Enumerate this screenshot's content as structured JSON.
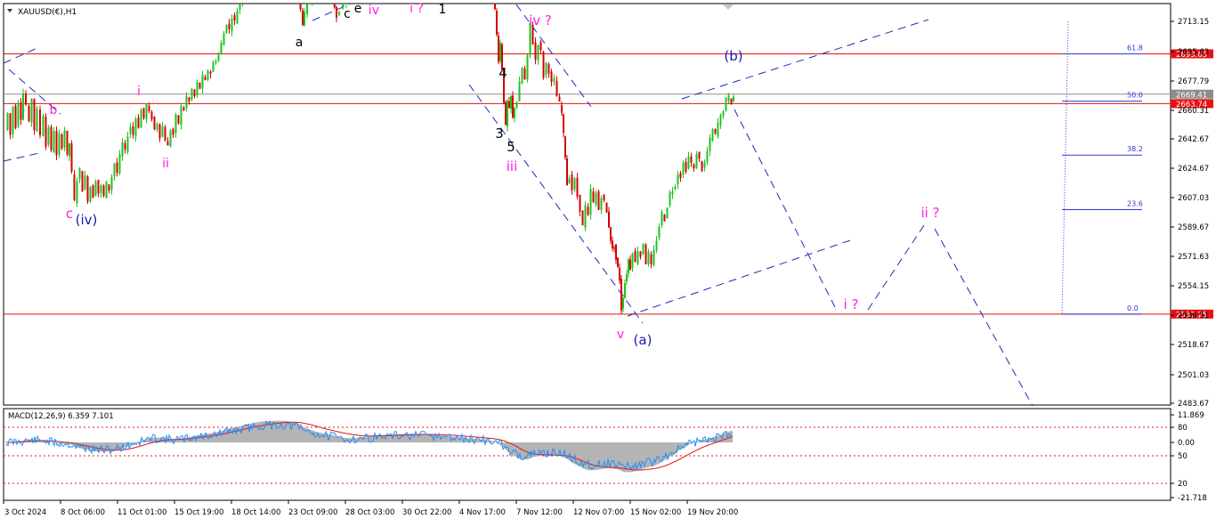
{
  "window": {
    "symbol_label": "XAUUSD(€),H1"
  },
  "chart_data": {
    "type": "candlestick",
    "symbol": "XAUUSD(€)",
    "timeframe": "H1",
    "ylim": [
      2483.67,
      2720.0
    ],
    "y_ticks": [
      "2713.15",
      "2695.63",
      "2677.79",
      "2660.31",
      "2642.67",
      "2624.67",
      "2607.03",
      "2589.67",
      "2571.63",
      "2554.15",
      "2536.51",
      "2518.67",
      "2501.03",
      "2483.67"
    ],
    "x_ticks": [
      "3 Oct 2024",
      "8 Oct 06:00",
      "11 Oct 01:00",
      "15 Oct 19:00",
      "18 Oct 14:00",
      "23 Oct 09:00",
      "28 Oct 03:00",
      "30 Oct 22:00",
      "4 Nov 17:00",
      "7 Nov 12:00",
      "12 Nov 07:00",
      "15 Nov 02:00",
      "19 Nov 20:00"
    ],
    "colors": {
      "up": "#1ec31e",
      "down": "#d40000",
      "wave_magenta": "#ff1ee6",
      "wave_blue": "#1a1ab4",
      "level_red": "#e81010",
      "trend_blue": "#1e2ab4"
    },
    "price_series": [
      [
        0,
        2648
      ],
      [
        3,
        2658
      ],
      [
        6,
        2645
      ],
      [
        9,
        2662
      ],
      [
        12,
        2650
      ],
      [
        15,
        2665
      ],
      [
        18,
        2655
      ],
      [
        20,
        2670
      ],
      [
        24,
        2663
      ],
      [
        27,
        2652
      ],
      [
        30,
        2667
      ],
      [
        33,
        2648
      ],
      [
        36,
        2660
      ],
      [
        40,
        2645
      ],
      [
        43,
        2657
      ],
      [
        46,
        2638
      ],
      [
        49,
        2650
      ],
      [
        52,
        2635
      ],
      [
        55,
        2648
      ],
      [
        58,
        2632
      ],
      [
        61,
        2645
      ],
      [
        64,
        2638
      ],
      [
        67,
        2648
      ],
      [
        70,
        2632
      ],
      [
        72,
        2640
      ],
      [
        75,
        2622
      ],
      [
        78,
        2605
      ],
      [
        81,
        2618
      ],
      [
        84,
        2624
      ],
      [
        87,
        2612
      ],
      [
        90,
        2620
      ],
      [
        93,
        2606
      ],
      [
        96,
        2614
      ],
      [
        99,
        2608
      ],
      [
        102,
        2618
      ],
      [
        105,
        2610
      ],
      [
        108,
        2614
      ],
      [
        111,
        2608
      ],
      [
        114,
        2616
      ],
      [
        117,
        2612
      ],
      [
        120,
        2620
      ],
      [
        123,
        2628
      ],
      [
        126,
        2622
      ],
      [
        129,
        2632
      ],
      [
        132,
        2640
      ],
      [
        135,
        2635
      ],
      [
        138,
        2645
      ],
      [
        141,
        2650
      ],
      [
        144,
        2645
      ],
      [
        147,
        2655
      ],
      [
        150,
        2650
      ],
      [
        153,
        2660
      ],
      [
        156,
        2655
      ],
      [
        159,
        2663
      ],
      [
        162,
        2658
      ],
      [
        165,
        2655
      ],
      [
        168,
        2648
      ],
      [
        171,
        2652
      ],
      [
        174,
        2644
      ],
      [
        177,
        2650
      ],
      [
        180,
        2642
      ],
      [
        183,
        2638
      ],
      [
        186,
        2648
      ],
      [
        189,
        2645
      ],
      [
        192,
        2656
      ],
      [
        195,
        2652
      ],
      [
        198,
        2662
      ],
      [
        201,
        2660
      ],
      [
        204,
        2668
      ],
      [
        207,
        2665
      ],
      [
        210,
        2672
      ],
      [
        213,
        2668
      ],
      [
        216,
        2676
      ],
      [
        219,
        2673
      ],
      [
        222,
        2680
      ],
      [
        225,
        2677
      ],
      [
        228,
        2684
      ],
      [
        231,
        2682
      ],
      [
        234,
        2688
      ],
      [
        237,
        2690
      ],
      [
        240,
        2693
      ],
      [
        243,
        2700
      ],
      [
        246,
        2706
      ],
      [
        249,
        2712
      ],
      [
        252,
        2708
      ],
      [
        255,
        2716
      ],
      [
        258,
        2713
      ],
      [
        261,
        2720
      ],
      [
        264,
        2724
      ],
      [
        267,
        2728
      ],
      [
        270,
        2733
      ],
      [
        273,
        2736
      ],
      [
        276,
        2740
      ],
      [
        280,
        2744
      ],
      [
        284,
        2748
      ],
      [
        288,
        2750
      ],
      [
        292,
        2745
      ],
      [
        296,
        2748
      ],
      [
        300,
        2752
      ],
      [
        305,
        2754
      ],
      [
        310,
        2756
      ],
      [
        315,
        2752
      ],
      [
        320,
        2750
      ],
      [
        325,
        2746
      ],
      [
        329,
        2738
      ],
      [
        332,
        2720
      ],
      [
        334,
        2712
      ],
      [
        336,
        2718
      ],
      [
        340,
        2724
      ],
      [
        345,
        2728
      ],
      [
        350,
        2726
      ],
      [
        355,
        2730
      ],
      [
        360,
        2732
      ],
      [
        365,
        2728
      ],
      [
        370,
        2722
      ],
      [
        372,
        2716
      ],
      [
        376,
        2720
      ],
      [
        380,
        2724
      ],
      [
        384,
        2728
      ],
      [
        388,
        2732
      ],
      [
        392,
        2736
      ],
      [
        395,
        2740
      ],
      [
        400,
        2744
      ],
      [
        410,
        2748
      ],
      [
        420,
        2752
      ],
      [
        440,
        2756
      ],
      [
        460,
        2758
      ],
      [
        480,
        2755
      ],
      [
        500,
        2752
      ],
      [
        520,
        2750
      ],
      [
        540,
        2746
      ],
      [
        548,
        2735
      ],
      [
        550,
        2720
      ],
      [
        552,
        2705
      ],
      [
        554,
        2690
      ],
      [
        556,
        2700
      ],
      [
        558,
        2685
      ],
      [
        560,
        2665
      ],
      [
        562,
        2650
      ],
      [
        564,
        2665
      ],
      [
        566,
        2660
      ],
      [
        568,
        2668
      ],
      [
        570,
        2655
      ],
      [
        572,
        2662
      ],
      [
        575,
        2665
      ],
      [
        578,
        2676
      ],
      [
        581,
        2685
      ],
      [
        584,
        2678
      ],
      [
        587,
        2692
      ],
      [
        590,
        2712
      ],
      [
        593,
        2700
      ],
      [
        596,
        2690
      ],
      [
        599,
        2700
      ],
      [
        602,
        2695
      ],
      [
        605,
        2680
      ],
      [
        608,
        2688
      ],
      [
        611,
        2683
      ],
      [
        614,
        2676
      ],
      [
        617,
        2678
      ],
      [
        620,
        2668
      ],
      [
        623,
        2664
      ],
      [
        625,
        2658
      ],
      [
        627,
        2645
      ],
      [
        629,
        2632
      ],
      [
        631,
        2615
      ],
      [
        634,
        2620
      ],
      [
        637,
        2612
      ],
      [
        640,
        2618
      ],
      [
        643,
        2608
      ],
      [
        646,
        2600
      ],
      [
        649,
        2590
      ],
      [
        652,
        2602
      ],
      [
        655,
        2596
      ],
      [
        658,
        2612
      ],
      [
        661,
        2604
      ],
      [
        664,
        2610
      ],
      [
        667,
        2600
      ],
      [
        670,
        2608
      ],
      [
        673,
        2605
      ],
      [
        676,
        2598
      ],
      [
        678,
        2590
      ],
      [
        680,
        2582
      ],
      [
        682,
        2576
      ],
      [
        684,
        2578
      ],
      [
        686,
        2570
      ],
      [
        688,
        2565
      ],
      [
        690,
        2558
      ],
      [
        692,
        2540
      ],
      [
        694,
        2548
      ],
      [
        696,
        2556
      ],
      [
        698,
        2562
      ],
      [
        700,
        2570
      ],
      [
        702,
        2565
      ],
      [
        705,
        2575
      ],
      [
        708,
        2568
      ],
      [
        711,
        2576
      ],
      [
        714,
        2572
      ],
      [
        717,
        2580
      ],
      [
        720,
        2568
      ],
      [
        723,
        2574
      ],
      [
        726,
        2566
      ],
      [
        729,
        2575
      ],
      [
        732,
        2582
      ],
      [
        735,
        2590
      ],
      [
        738,
        2598
      ],
      [
        741,
        2594
      ],
      [
        744,
        2602
      ],
      [
        747,
        2610
      ],
      [
        750,
        2612
      ],
      [
        753,
        2615
      ],
      [
        756,
        2622
      ],
      [
        759,
        2620
      ],
      [
        762,
        2628
      ],
      [
        765,
        2624
      ],
      [
        768,
        2632
      ],
      [
        771,
        2628
      ],
      [
        774,
        2624
      ],
      [
        777,
        2634
      ],
      [
        780,
        2630
      ],
      [
        783,
        2624
      ],
      [
        786,
        2628
      ],
      [
        789,
        2635
      ],
      [
        792,
        2642
      ],
      [
        795,
        2648
      ],
      [
        798,
        2645
      ],
      [
        801,
        2652
      ],
      [
        804,
        2656
      ],
      [
        807,
        2660
      ],
      [
        810,
        2666
      ],
      [
        813,
        2668
      ],
      [
        816,
        2664
      ],
      [
        818,
        2668
      ]
    ],
    "macd": {
      "label": "MACD(12,26,9) 6.359 7.101",
      "fast": 12,
      "slow": 26,
      "signal": 9,
      "value": 6.359,
      "signal_value": 7.101,
      "y_ticks": [
        "11.869",
        "80",
        "0.00",
        "50",
        "20",
        "-21.718"
      ]
    },
    "levels": {
      "horizontal_lines": [
        {
          "price": 2693.65,
          "label": "2693.65",
          "color": "#e81010"
        },
        {
          "price": 2669.41,
          "label": "2669.41",
          "color": "#8c8c8c"
        },
        {
          "price": 2663.74,
          "label": "2663.74",
          "color": "#e81010"
        },
        {
          "price": 2537.25,
          "label": "2537.25",
          "color": "#e81010"
        }
      ],
      "fibonacci": [
        {
          "pct": "61.8",
          "price": 2693.65
        },
        {
          "pct": "50.0",
          "price": 2665.2
        },
        {
          "pct": "38.2",
          "price": 2632.8
        },
        {
          "pct": "23.6",
          "price": 2600.0
        },
        {
          "pct": "0.0",
          "price": 2537.25
        }
      ]
    },
    "wave_labels": [
      {
        "text": "b",
        "color": "#ff1ee6"
      },
      {
        "text": "i",
        "color": "#ff1ee6"
      },
      {
        "text": "ii",
        "color": "#ff1ee6"
      },
      {
        "text": "c",
        "color": "#ff1ee6"
      },
      {
        "text": "(iv)",
        "color": "#1a1ab4"
      },
      {
        "text": "a",
        "color": "#000000"
      },
      {
        "text": "c",
        "color": "#000000"
      },
      {
        "text": "e",
        "color": "#000000"
      },
      {
        "text": "iv",
        "color": "#ff1ee6"
      },
      {
        "text": "i ?",
        "color": "#ff1ee6"
      },
      {
        "text": "1",
        "color": "#000000"
      },
      {
        "text": "4",
        "color": "#000000"
      },
      {
        "text": "3",
        "color": "#000000"
      },
      {
        "text": "5",
        "color": "#000000"
      },
      {
        "text": "iii",
        "color": "#ff1ee6"
      },
      {
        "text": "iv ?",
        "color": "#ff1ee6"
      },
      {
        "text": "v",
        "color": "#ff1ee6"
      },
      {
        "text": "(a)",
        "color": "#1a1ab4"
      },
      {
        "text": "(b)",
        "color": "#1a1ab4"
      },
      {
        "text": "i ?",
        "color": "#ff1ee6"
      },
      {
        "text": "ii ?",
        "color": "#ff1ee6"
      }
    ]
  }
}
